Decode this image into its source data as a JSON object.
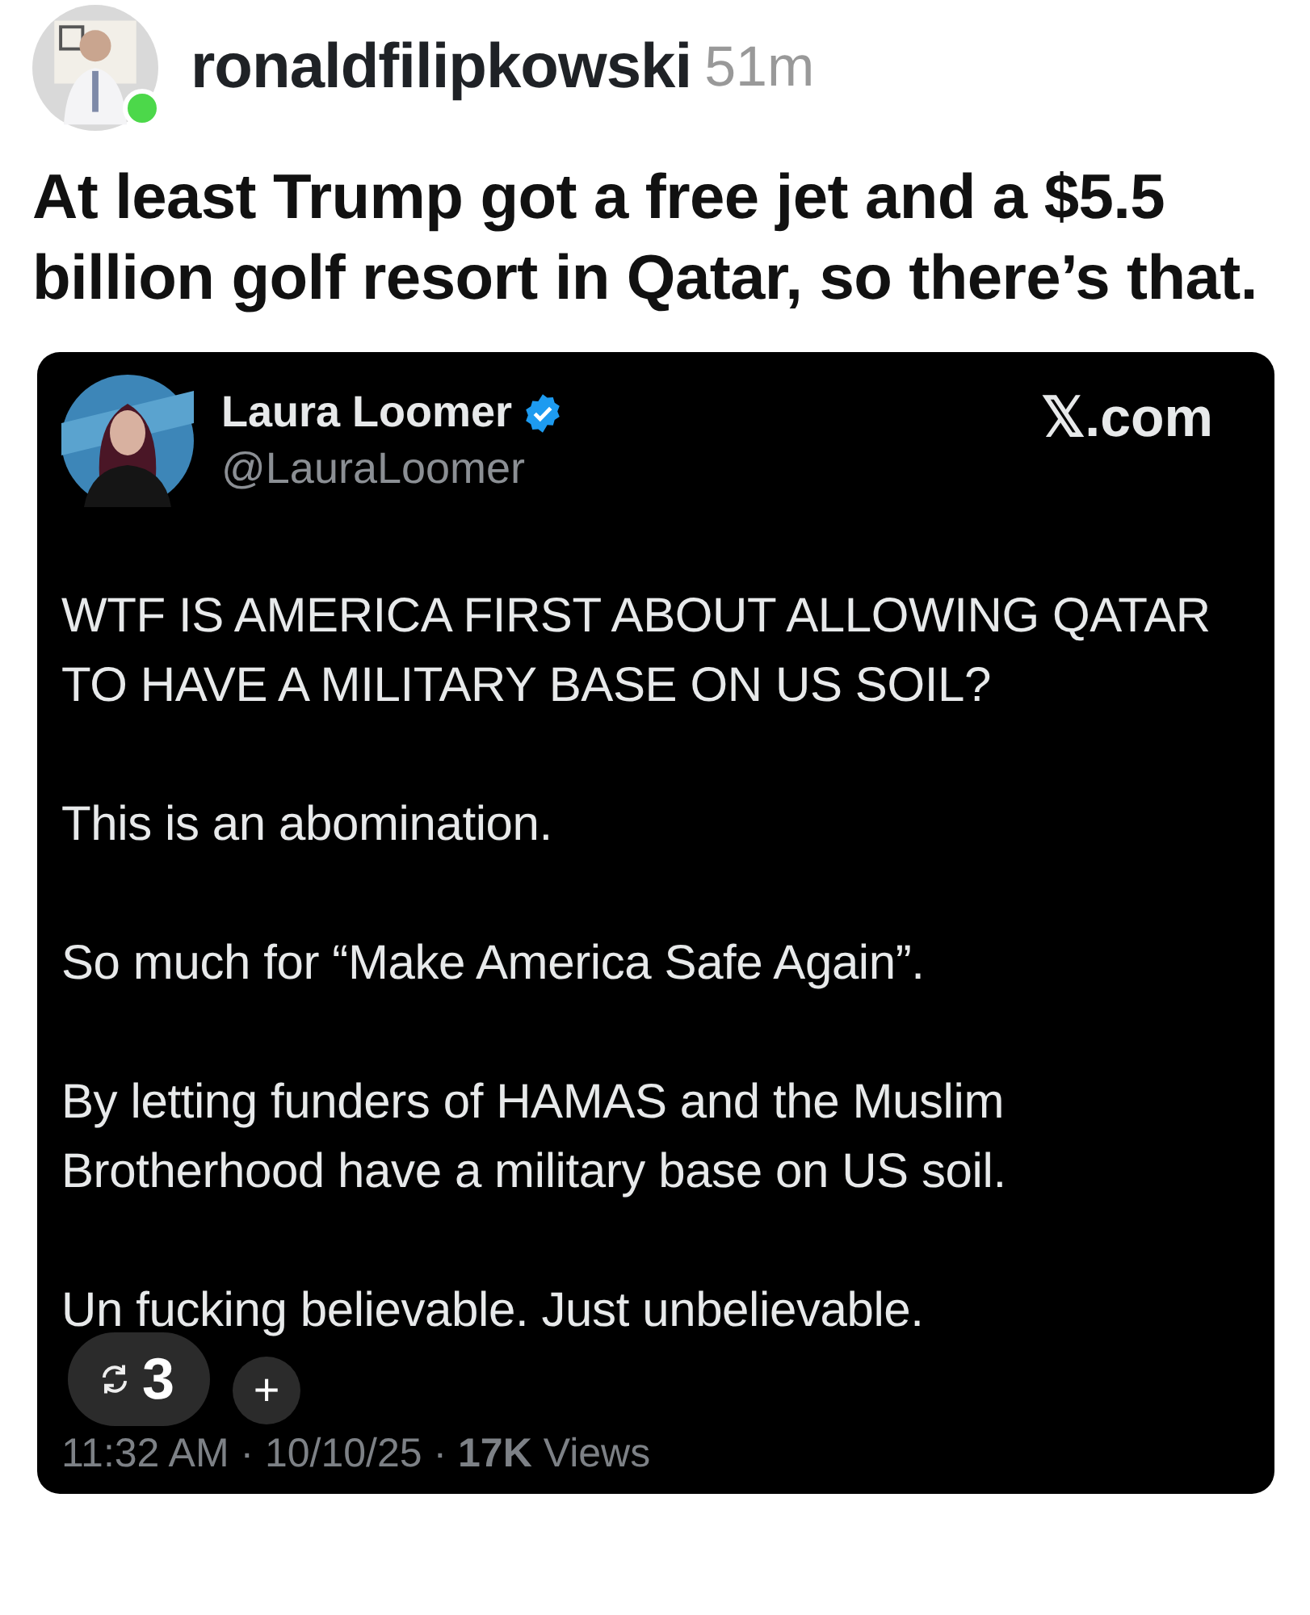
{
  "post": {
    "author": "ronaldfilipkowski",
    "time": "51m",
    "online": true,
    "text": "At least Trump got a free jet and a $5.5 billion golf resort in Qatar, so there’s that."
  },
  "embed": {
    "name": "Laura Loomer",
    "verified": true,
    "handle": "@LauraLoomer",
    "source": "𝕏.com",
    "paragraphs": [
      "WTF IS AMERICA FIRST ABOUT ALLOWING QATAR TO HAVE A MILITARY BASE ON US SOIL?",
      "This is an abomination.",
      "So much for “Make America Safe Again”.",
      "By letting funders of HAMAS and the Muslim Brotherhood have a military base on US soil.",
      "Un fucking believable. Just unbelievable."
    ],
    "footer": "11:32 AM · 10/10/25 · **17K** Views"
  },
  "overlay": {
    "repost_count": "3",
    "add": "+"
  }
}
